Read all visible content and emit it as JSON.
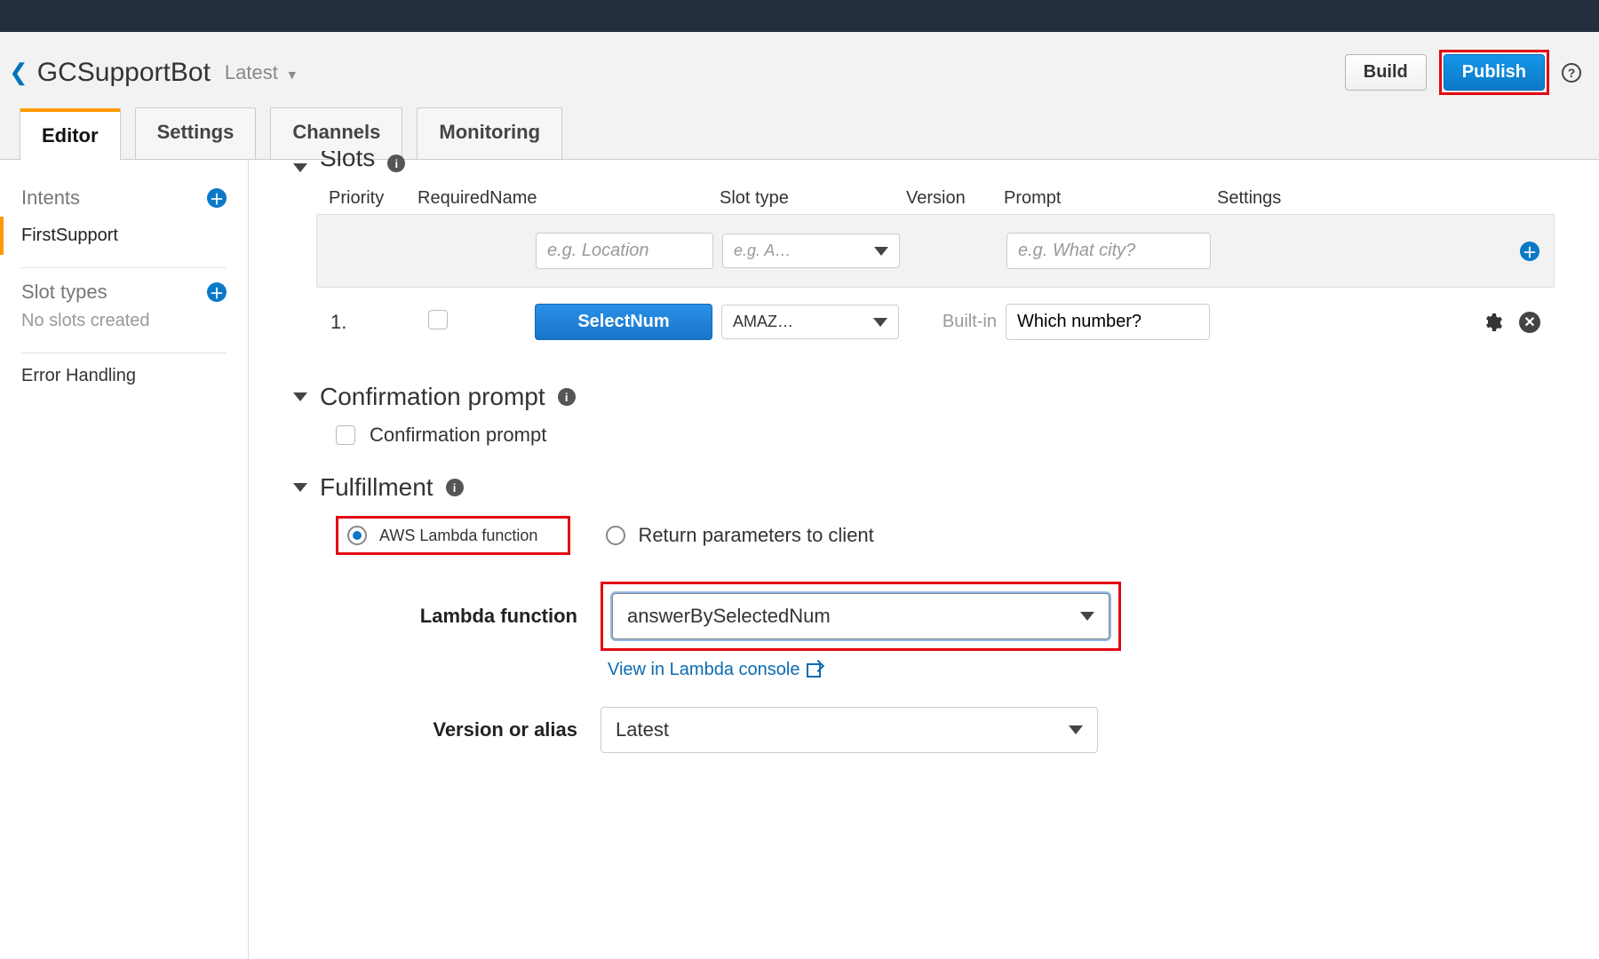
{
  "header": {
    "bot_name": "GCSupportBot",
    "version_label": "Latest",
    "build_label": "Build",
    "publish_label": "Publish"
  },
  "tabs": {
    "editor": "Editor",
    "settings": "Settings",
    "channels": "Channels",
    "monitoring": "Monitoring"
  },
  "sidebar": {
    "intents_label": "Intents",
    "intent_item": "FirstSupport",
    "slot_types_label": "Slot types",
    "no_slots": "No slots created",
    "error_handling": "Error Handling"
  },
  "slots": {
    "title": "Slots",
    "columns": {
      "priority": "Priority",
      "required_name": "RequiredName",
      "slot_type": "Slot type",
      "version": "Version",
      "prompt": "Prompt",
      "settings": "Settings"
    },
    "placeholders": {
      "name": "e.g. Location",
      "type": "e.g. A…",
      "prompt": "e.g. What city?"
    },
    "row1": {
      "priority": "1.",
      "name": "SelectNum",
      "type": "AMAZ…",
      "version": "Built-in",
      "prompt": "Which number?"
    }
  },
  "confirmation": {
    "title": "Confirmation prompt",
    "checkbox_label": "Confirmation prompt"
  },
  "fulfillment": {
    "title": "Fulfillment",
    "radio_lambda": "AWS Lambda function",
    "radio_return": "Return parameters to client",
    "lambda_label": "Lambda function",
    "lambda_value": "answerBySelectedNum",
    "view_link": "View in Lambda console",
    "version_label": "Version or alias",
    "version_value": "Latest"
  }
}
